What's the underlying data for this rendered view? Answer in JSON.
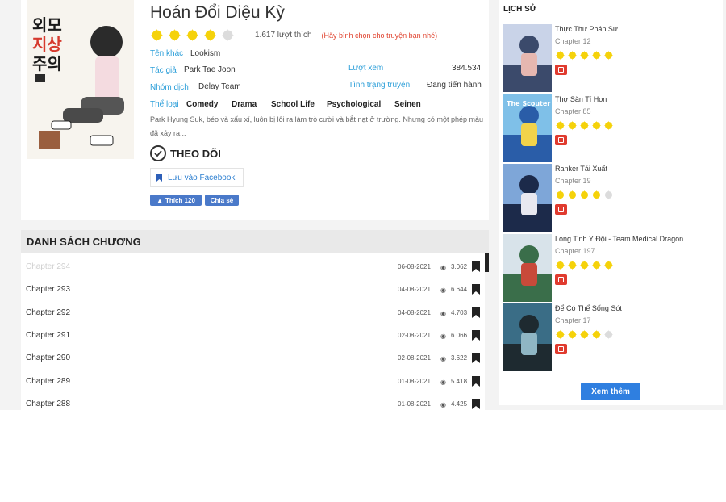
{
  "colors": {
    "star_on": "#f5d20a",
    "star_off": "#dcdcdc",
    "label_blue": "#2d9fd9",
    "fb_blue": "#4a79c9",
    "danger": "#e03b2f",
    "button_blue": "#2f7fe0"
  },
  "manga": {
    "cover_text": "외모 지상 주의",
    "title": "Hoán Đổi Diệu Kỳ",
    "rating_filled": 4,
    "rating_max": 5,
    "like_count": "1.617 lượt thích",
    "vote_hint": "(Hãy bình chọn cho truyện bạn nhé)",
    "alt_name_label": "Tên khác",
    "alt_name": "Lookism",
    "author_label": "Tác giả",
    "author": "Park Tae Joon",
    "views_label": "Lượt xem",
    "views": "384.534",
    "translator_label": "Nhóm dịch",
    "translator": "Delay Team",
    "status_label": "Tình trạng truyện",
    "status": "Đang tiến hành",
    "genres_label": "Thể loại",
    "genres": [
      "Comedy",
      "Drama",
      "School Life",
      "Psychological",
      "Seinen"
    ],
    "description": "Park Hyung Suk, béo và xấu xí, luôn bị lôi ra làm trò cười và bắt nạt ở trường. Nhưng có một phép màu đã xảy ra..."
  },
  "actions": {
    "follow_label": "THEO DÕI",
    "save_fb_label": "Lưu vào Facebook",
    "fb_like_label": "Thích 120",
    "fb_share_label": "Chia sẻ"
  },
  "chapters": {
    "header": "DANH SÁCH CHƯƠNG",
    "rows": [
      {
        "name": "Chapter 294",
        "date": "06-08-2021",
        "views": "3.062"
      },
      {
        "name": "Chapter 293",
        "date": "04-08-2021",
        "views": "6.644"
      },
      {
        "name": "Chapter 292",
        "date": "04-08-2021",
        "views": "4.703"
      },
      {
        "name": "Chapter 291",
        "date": "02-08-2021",
        "views": "6.066"
      },
      {
        "name": "Chapter 290",
        "date": "02-08-2021",
        "views": "3.622"
      },
      {
        "name": "Chapter 289",
        "date": "01-08-2021",
        "views": "5.418"
      },
      {
        "name": "Chapter 288",
        "date": "01-08-2021",
        "views": "4.425"
      }
    ]
  },
  "history": {
    "title": "LỊCH SỬ",
    "items": [
      {
        "name": "Thực Thư Pháp Sư",
        "chapter": "Chapter 12",
        "rating_filled": 5,
        "cover_text": ""
      },
      {
        "name": "Thợ Săn Tí Hon",
        "chapter": "Chapter 85",
        "rating_filled": 5,
        "cover_text": "The Scouter"
      },
      {
        "name": "Ranker Tái Xuất",
        "chapter": "Chapter 19",
        "rating_filled": 4,
        "cover_text": ""
      },
      {
        "name": "Long Tinh Y Đội - Team Medical Dragon",
        "chapter": "Chapter 197",
        "rating_filled": 5,
        "cover_text": ""
      },
      {
        "name": "Để Có Thể Sống Sót",
        "chapter": "Chapter 17",
        "rating_filled": 4,
        "cover_text": ""
      }
    ],
    "more_label": "Xem thêm"
  }
}
